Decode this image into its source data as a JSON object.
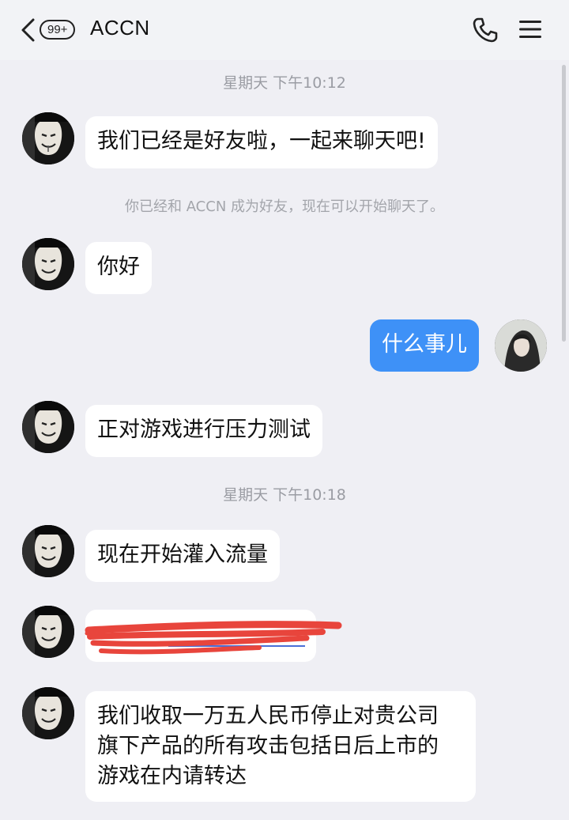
{
  "header": {
    "back_label": "back",
    "unread_badge": "99+",
    "title": "ACCN",
    "icons": [
      "chevron-left-icon",
      "phone-icon",
      "menu-icon"
    ]
  },
  "messages": {
    "time_1": "星期天 下午10:12",
    "msg_1": "我们已经是好友啦，一起来聊天吧!",
    "system_1": "你已经和 ACCN 成为好友，现在可以开始聊天了。",
    "msg_2": "你好",
    "msg_3_me": "什么事儿",
    "msg_4": "正对游戏进行压力测试",
    "time_2": "星期天 下午10:18",
    "msg_5": "现在开始灌入流量",
    "msg_7_line1": "我们收取一万五人民币停止对贵公司",
    "msg_7_line2": "旗下产品的所有攻击包括日后上市的",
    "msg_7_line3": "游戏在内请转达"
  },
  "colors": {
    "background": "#efeff4",
    "my_bubble": "#3e91f7",
    "their_bubble": "#ffffff",
    "redaction": "#e8453c"
  }
}
